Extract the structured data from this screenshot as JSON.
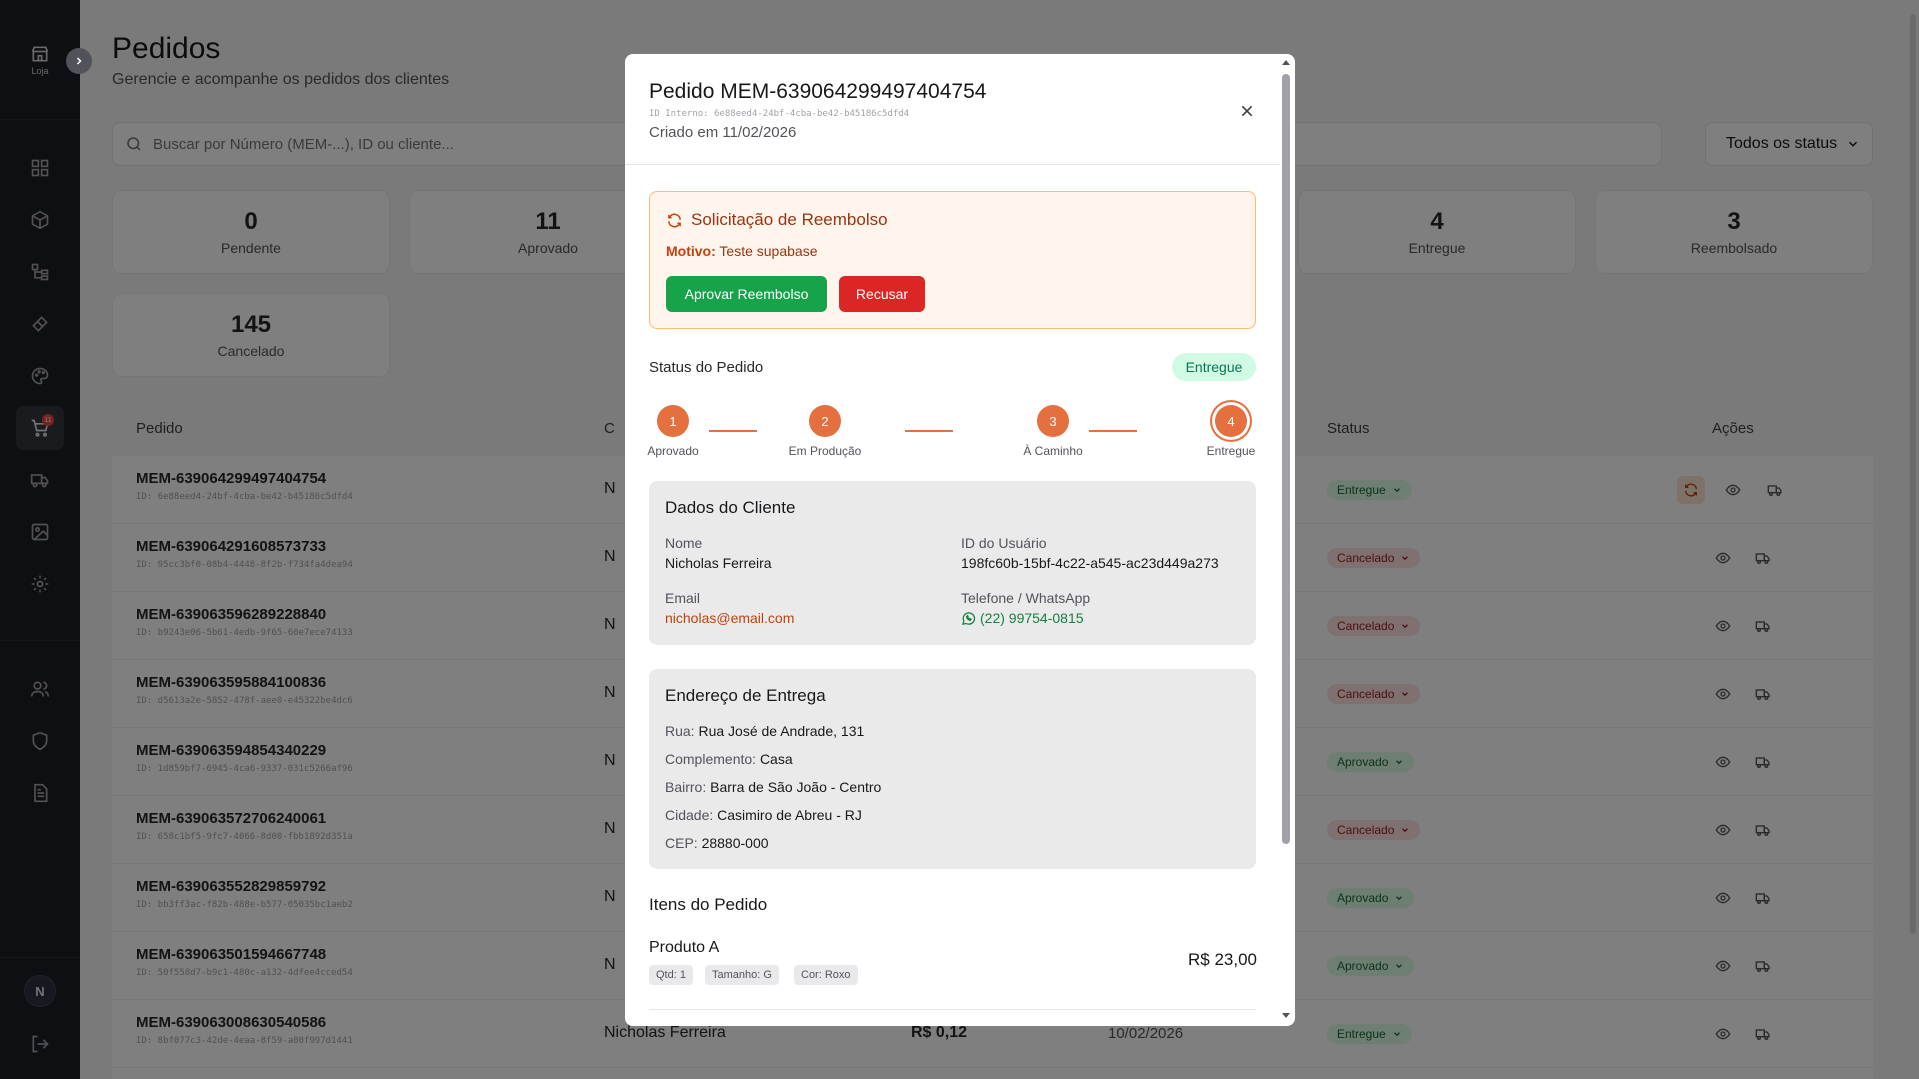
{
  "sidebar": {
    "logo_label": "Loja",
    "cart_badge": "11",
    "avatar_initial": "N"
  },
  "page": {
    "title": "Pedidos",
    "subtitle": "Gerencie e acompanhe os pedidos dos clientes",
    "search_placeholder": "Buscar por Número (MEM-...), ID ou cliente...",
    "status_filter": "Todos os status"
  },
  "stats": [
    {
      "value": "0",
      "label": "Pendente"
    },
    {
      "value": "11",
      "label": "Aprovado"
    },
    {
      "value": "4",
      "label": "Entregue"
    },
    {
      "value": "3",
      "label": "Reembolsado"
    },
    {
      "value": "145",
      "label": "Cancelado"
    }
  ],
  "table": {
    "headers": {
      "order": "Pedido",
      "client": "C",
      "status": "Status",
      "actions": "Ações"
    },
    "rows": [
      {
        "order": "MEM-639064299497404754",
        "id": "ID: 6e88eed4-24bf-4cba-be42-b45186c5dfd4",
        "client": "N",
        "value": "",
        "date": "",
        "status": "Entregue",
        "tone": "green"
      },
      {
        "order": "MEM-639064291608573733",
        "id": "ID: 95cc3bf0-08b4-4448-8f2b-f734fa4dea94",
        "client": "N",
        "value": "",
        "date": "",
        "status": "Cancelado",
        "tone": "red"
      },
      {
        "order": "MEM-639063596289228840",
        "id": "ID: b9243e06-5b61-4edb-9f65-60e7ece74133",
        "client": "N",
        "value": "",
        "date": "",
        "status": "Cancelado",
        "tone": "red"
      },
      {
        "order": "MEM-639063595884100836",
        "id": "ID: d5613a2e-5852-478f-aee0-e45322be4dc6",
        "client": "N",
        "value": "",
        "date": "",
        "status": "Cancelado",
        "tone": "red"
      },
      {
        "order": "MEM-639063594854340229",
        "id": "ID: 1d859bf7-6945-4ca6-9337-031c5266af96",
        "client": "N",
        "value": "",
        "date": "",
        "status": "Aprovado",
        "tone": "green"
      },
      {
        "order": "MEM-639063572706240061",
        "id": "ID: 658c1bf5-9fc7-4066-8d00-fbb1892d351a",
        "client": "N",
        "value": "",
        "date": "",
        "status": "Cancelado",
        "tone": "red"
      },
      {
        "order": "MEM-639063552829859792",
        "id": "ID: bb3ff3ac-f82b-488e-b577-05035bc1aeb2",
        "client": "N",
        "value": "",
        "date": "",
        "status": "Aprovado",
        "tone": "green"
      },
      {
        "order": "MEM-639063501594667748",
        "id": "ID: 50f558d7-b9c1-480c-a132-4dfee4cced54",
        "client": "N",
        "value": "",
        "date": "",
        "status": "Aprovado",
        "tone": "green"
      },
      {
        "order": "MEM-639063008630540586",
        "id": "ID: 8bf077c3-42de-4eaa-8f59-a80f997d1441",
        "client": "Nicholas Ferreira",
        "value": "R$ 0,12",
        "date": "10/02/2026",
        "status": "Entregue",
        "tone": "green"
      }
    ]
  },
  "modal": {
    "title": "Pedido MEM-639064299497404754",
    "internal_id": "ID Interno: 6e88eed4-24bf-4cba-be42-b45186c5dfd4",
    "created": "Criado em 11/02/2026",
    "refund": {
      "title": "Solicitação de Reembolso",
      "reason_label": "Motivo:",
      "reason": "Teste supabase",
      "approve": "Aprovar Reembolso",
      "refuse": "Recusar"
    },
    "status_label": "Status do Pedido",
    "status": "Entregue",
    "steps": [
      {
        "n": "1",
        "label": "Aprovado"
      },
      {
        "n": "2",
        "label": "Em Produção"
      },
      {
        "n": "3",
        "label": "À Caminho"
      },
      {
        "n": "4",
        "label": "Entregue"
      }
    ],
    "client": {
      "title": "Dados do Cliente",
      "name_label": "Nome",
      "name": "Nicholas Ferreira",
      "user_id_label": "ID do Usuário",
      "user_id": "198fc60b-15bf-4c22-a545-ac23d449a273",
      "email_label": "Email",
      "email": "nicholas@email.com",
      "phone_label": "Telefone / WhatsApp",
      "phone": "(22) 99754-0815"
    },
    "address": {
      "title": "Endereço de Entrega",
      "street_label": "Rua:",
      "street": "Rua José de Andrade, 131",
      "complement_label": "Complemento:",
      "complement": "Casa",
      "district_label": "Bairro:",
      "district": "Barra de São João - Centro",
      "city_label": "Cidade:",
      "city": "Casimiro de Abreu - RJ",
      "zip_label": "CEP:",
      "zip": "28880-000"
    },
    "items_title": "Itens do Pedido",
    "items": [
      {
        "name": "Produto A",
        "price": "R$ 23,00",
        "qty": "Qtd: 1",
        "size": "Tamanho: G",
        "color": "Cor: Roxo"
      }
    ]
  },
  "colors": {
    "accent": "#e4703f",
    "approve": "#16a34a",
    "refuse": "#dc2626",
    "sidebar": "#1c1f26"
  }
}
